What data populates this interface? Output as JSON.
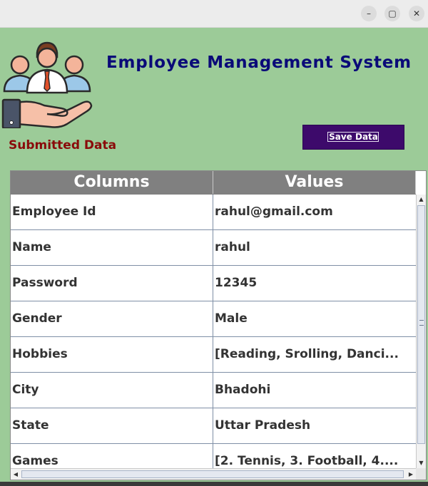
{
  "window": {
    "minimize_glyph": "–",
    "maximize_glyph": "▢",
    "close_glyph": "✕"
  },
  "header": {
    "title": "Employee Management System",
    "logo_icon": "employees-in-hand-icon"
  },
  "section": {
    "label": "Submitted Data"
  },
  "actions": {
    "save_label": "Save Data"
  },
  "table": {
    "columns": [
      "Columns",
      "Values"
    ],
    "rows": [
      {
        "field": "Employee Id",
        "value": "rahul@gmail.com"
      },
      {
        "field": "Name",
        "value": "rahul"
      },
      {
        "field": "Password",
        "value": "12345"
      },
      {
        "field": "Gender",
        "value": "Male"
      },
      {
        "field": "Hobbies",
        "value": "[Reading, Srolling, Danci..."
      },
      {
        "field": "City",
        "value": "Bhadohi"
      },
      {
        "field": "State",
        "value": "Uttar Pradesh"
      },
      {
        "field": "Games",
        "value": "[2. Tennis, 3. Football, 4...."
      }
    ]
  },
  "colors": {
    "background": "#9ccb98",
    "title": "#0a0a78",
    "section_label": "#8a0a0a",
    "button": "#3d0a6b",
    "table_header": "#808080"
  }
}
